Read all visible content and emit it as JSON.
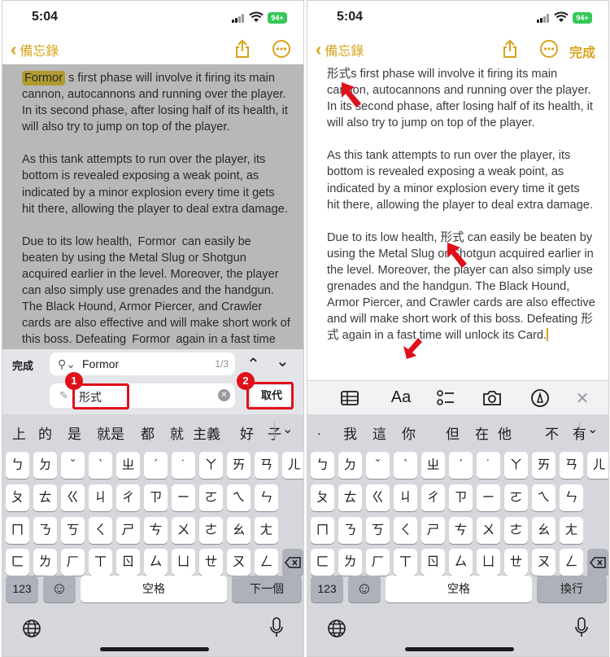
{
  "status": {
    "time": "5:04",
    "battery": "94+"
  },
  "nav": {
    "back_label": "備忘錄",
    "done_label": "完成"
  },
  "note_left": {
    "p1_a": "Formor",
    "p1_b": " s first phase will involve it firing its main cannon, autocannons and running over the player. In its second phase, after losing half of its health, it will also try to jump on top of the player.",
    "p2": "As this tank attempts to run over the player, its bottom is revealed exposing a weak point, as indicated by a minor explosion every time it gets hit there, allowing the player to deal extra damage.",
    "p3_a": "Due to its low health, ",
    "p3_b": "Formor",
    "p3_c": " can easily be beaten by using the Metal Slug or Shotgun acquired earlier in the level. Moreover, the player can also simply use grenades and the handgun. The Black Hound, Armor Piercer, and Crawler cards are also effective and will make short work of this boss. Defeating ",
    "p3_d": "Formor",
    "p3_e": " again in a fast time will unlock its"
  },
  "note_right": {
    "p1_a": "形式",
    "p1_b": "s first phase will involve it firing its main cannon, autocannons and running over the player. In its second phase, after losing half of its health, it will also try to jump on top of the player.",
    "p2": "As this tank attempts to run over the player, its bottom is revealed exposing a weak point, as indicated by a minor explosion every time it gets hit there, allowing the player to deal extra damage.",
    "p3_a": "Due to its low health, ",
    "p3_b": "形式",
    "p3_c": " can easily be beaten by using the Metal Slug or Shotgun acquired earlier in the level. Moreover, the player can also simply use grenades and the handgun. The Black Hound, Armor Piercer, and Crawler cards are also effective and will make short work of this boss. Defeating ",
    "p3_d": "形式",
    "p3_e": " again in a fast time will unlock its Card."
  },
  "find": {
    "done_label": "完成",
    "query": "Formor",
    "count": "1/3",
    "replace_value": "形式",
    "replace_button": "取代",
    "badge1": "1",
    "badge2": "2"
  },
  "toolbar_right": {
    "format_label": "Aa"
  },
  "candidates_left": [
    "上",
    "的",
    "是",
    "就是",
    "都",
    "就",
    "主義",
    "好",
    "子"
  ],
  "candidates_right": [
    ".",
    "我",
    "這",
    "你",
    "但",
    "在",
    "他",
    "不",
    "有"
  ],
  "keys": {
    "row1": [
      "ㄅ",
      "ㄉ",
      "ˇ",
      "ˋ",
      "ㄓ",
      "ˊ",
      "˙",
      "ㄚ",
      "ㄞ",
      "ㄢ",
      "ㄦ"
    ],
    "row2": [
      "ㄆ",
      "ㄊ",
      "ㄍ",
      "ㄐ",
      "ㄔ",
      "ㄗ",
      "ㄧ",
      "ㄛ",
      "ㄟ",
      "ㄣ"
    ],
    "row3": [
      "ㄇ",
      "ㄋ",
      "ㄎ",
      "ㄑ",
      "ㄕ",
      "ㄘ",
      "ㄨ",
      "ㄜ",
      "ㄠ",
      "ㄤ"
    ],
    "row4": [
      "ㄈ",
      "ㄌ",
      "ㄏ",
      "ㄒ",
      "ㄖ",
      "ㄙ",
      "ㄩ",
      "ㄝ",
      "ㄡ",
      "ㄥ"
    ],
    "numbers": "123",
    "space": "空格",
    "next_left": "下一個",
    "next_right": "換行"
  },
  "colors": {
    "accent": "#d6a31a",
    "annotation_red": "#e0101a",
    "search_highlight": "#f5d742"
  }
}
